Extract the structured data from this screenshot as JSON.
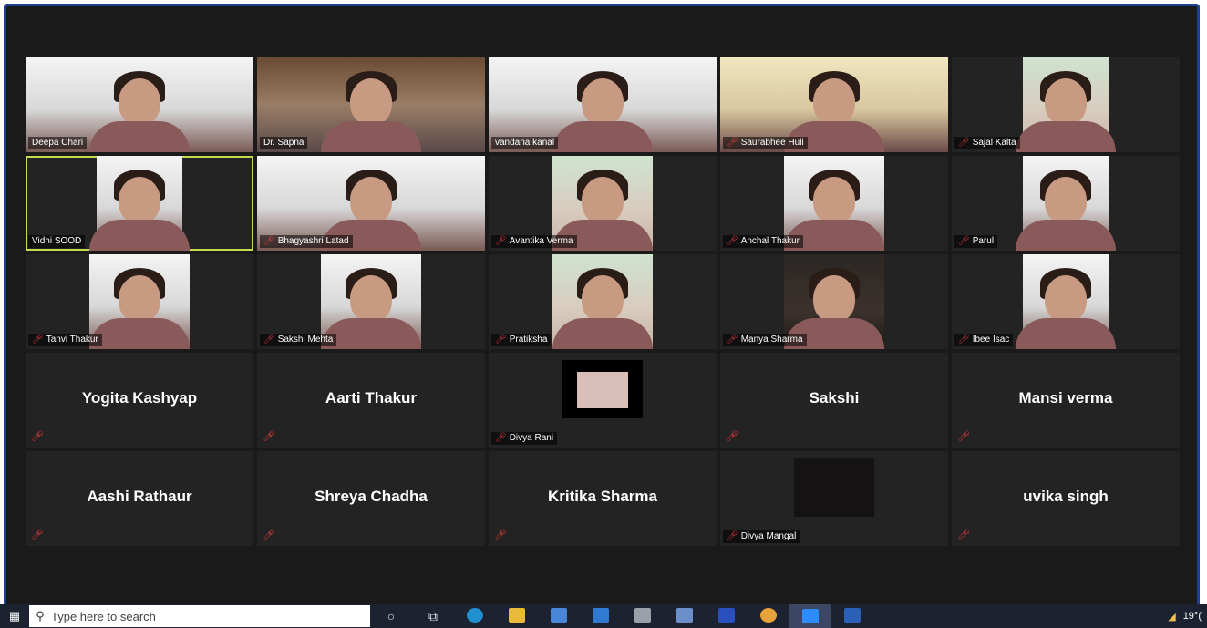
{
  "participants_video": [
    {
      "name": "Deepa Chari",
      "muted": false,
      "style": "full light"
    },
    {
      "name": "Dr. Sapna",
      "muted": false,
      "style": "full wood"
    },
    {
      "name": "vandana kanal",
      "muted": false,
      "style": "full light"
    },
    {
      "name": "Saurabhee Huli",
      "muted": true,
      "style": "full warm"
    },
    {
      "name": "Sajal Kalta",
      "muted": true,
      "style": "narrow green"
    },
    {
      "name": "Vidhi SOOD",
      "muted": false,
      "style": "narrow light",
      "active": true
    },
    {
      "name": "Bhagyashri Latad",
      "muted": true,
      "style": "full light"
    },
    {
      "name": "Avantika Verma",
      "muted": true,
      "style": "mid green"
    },
    {
      "name": "Anchal Thakur",
      "muted": true,
      "style": "mid light"
    },
    {
      "name": "Parul",
      "muted": true,
      "style": "narrow light"
    },
    {
      "name": "Tanvi Thakur",
      "muted": true,
      "style": "mid light"
    },
    {
      "name": "Sakshi Mehta",
      "muted": true,
      "style": "mid light"
    },
    {
      "name": "Pratiksha",
      "muted": true,
      "style": "mid green"
    },
    {
      "name": "Manya Sharma",
      "muted": true,
      "style": "mid dark"
    },
    {
      "name": "Ibee Isac",
      "muted": true,
      "style": "narrow light"
    }
  ],
  "participants_names_row1": [
    {
      "name": "Yogita Kashyap",
      "type": "name"
    },
    {
      "name": "Aarti Thakur",
      "type": "name"
    },
    {
      "name": "Divya Rani",
      "type": "thumb"
    },
    {
      "name": "Sakshi",
      "type": "name"
    },
    {
      "name": "Mansi verma",
      "type": "name"
    }
  ],
  "participants_names_row2": [
    {
      "name": "Aashi Rathaur",
      "type": "name"
    },
    {
      "name": "Shreya Chadha",
      "type": "name"
    },
    {
      "name": "Kritika Sharma",
      "type": "name"
    },
    {
      "name": "Divya Mangal",
      "type": "thumb-blank"
    },
    {
      "name": "uvika singh",
      "type": "name"
    }
  ],
  "taskbar": {
    "search_placeholder": "Type here to search",
    "temperature": "19°("
  },
  "colors": {
    "active_speaker_border": "#c7d94c",
    "muted_icon": "#e23b3b",
    "tile_bg": "#232323",
    "meeting_bg": "#1a1a1a",
    "taskbar_bg": "#1c2230"
  }
}
